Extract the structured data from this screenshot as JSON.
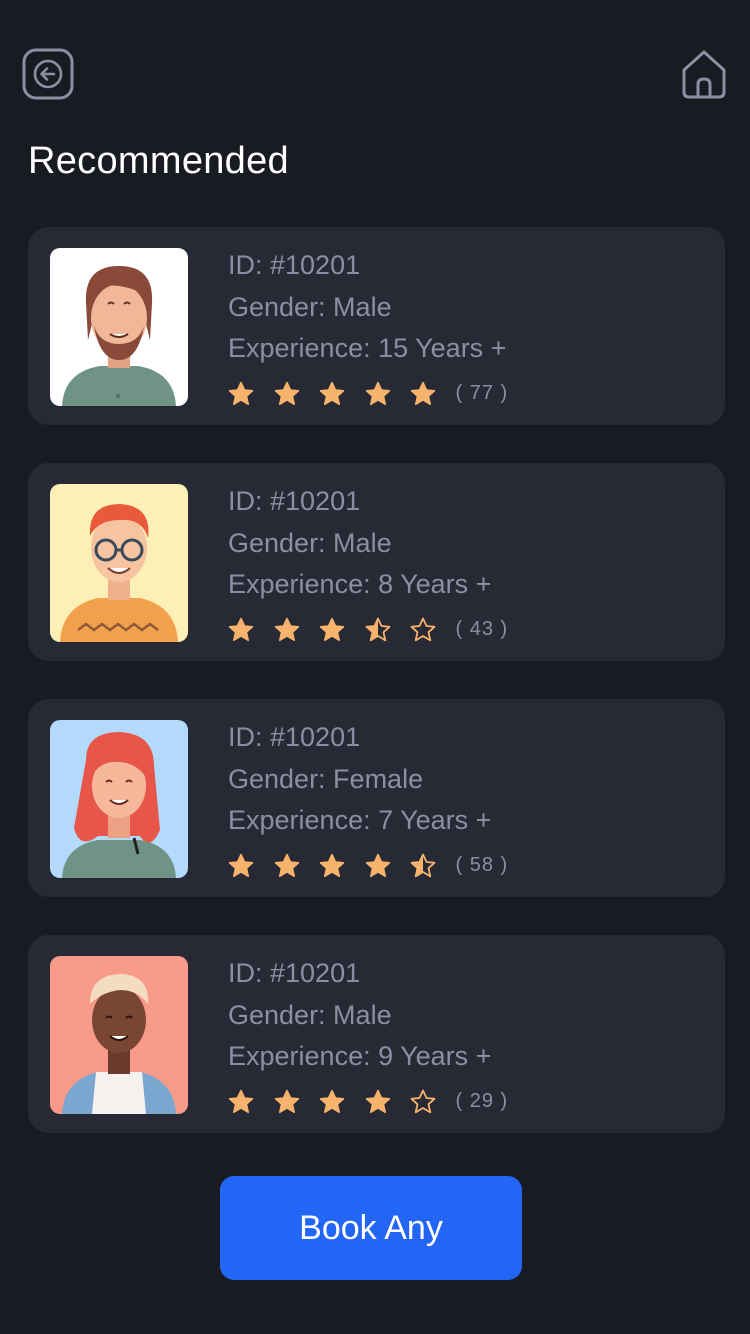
{
  "header": {
    "back_icon": "arrow-left-icon",
    "home_icon": "home-icon",
    "title": "Recommended"
  },
  "colors": {
    "background": "#181b22",
    "card": "#272a35",
    "star": "#f7b26b",
    "muted_text": "#8b8fa3",
    "primary": "#2366f5"
  },
  "doctors": [
    {
      "id": "ID: #10201",
      "gender": "Gender: Male",
      "experience": "Experience: 15 Years +",
      "rating": 5,
      "reviews": "( 77 )",
      "avatar_bg": "#ffffff"
    },
    {
      "id": "ID: #10201",
      "gender": "Gender: Male",
      "experience": "Experience: 8 Years +",
      "rating": 3.5,
      "reviews": "( 43 )",
      "avatar_bg": "#fdf0b6"
    },
    {
      "id": "ID: #10201",
      "gender": "Gender: Female",
      "experience": "Experience: 7 Years +",
      "rating": 4.5,
      "reviews": "( 58 )",
      "avatar_bg": "#b3d9fb"
    },
    {
      "id": "ID: #10201",
      "gender": "Gender: Male",
      "experience": "Experience: 9 Years +",
      "rating": 4,
      "reviews": "( 29 )",
      "avatar_bg": "#f89a8a"
    }
  ],
  "book_button": "Book Any"
}
